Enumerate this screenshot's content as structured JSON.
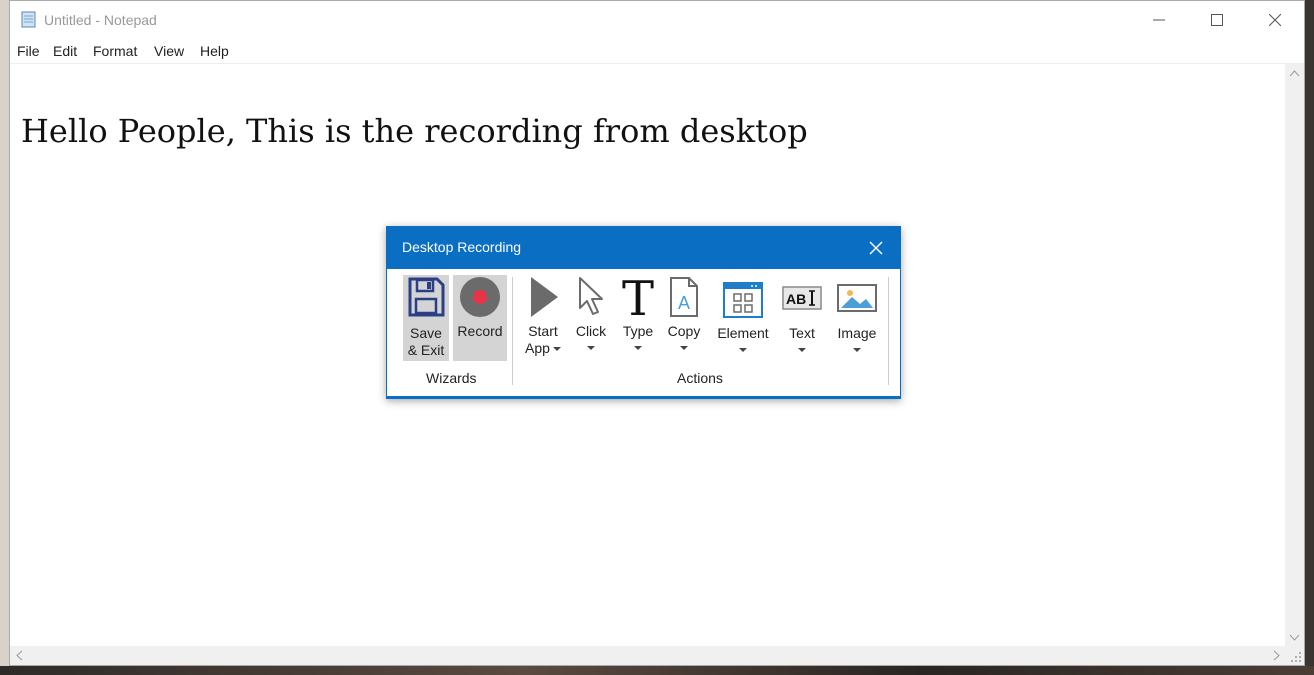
{
  "window": {
    "title": "Untitled - Notepad",
    "icon": "notepad-icon",
    "controls": [
      "minimize-icon",
      "maximize-icon",
      "close-icon"
    ]
  },
  "menu": [
    "File",
    "Edit",
    "Format",
    "View",
    "Help"
  ],
  "editor": {
    "text": "Hello People, This is the recording from desktop"
  },
  "dialog": {
    "title": "Desktop Recording",
    "groups": {
      "wizards": "Wizards",
      "actions": "Actions"
    },
    "tools": {
      "save_exit_1": "Save",
      "save_exit_2": "& Exit",
      "record": "Record",
      "start_app_1": "Start",
      "start_app_2": "App",
      "click": "Click",
      "type": "Type",
      "copy": "Copy",
      "element": "Element",
      "text": "Text",
      "image": "Image"
    }
  },
  "colors": {
    "accent": "#0a6fc2",
    "record_dot": "#e8344a",
    "highlight": "#d4d4d4"
  }
}
